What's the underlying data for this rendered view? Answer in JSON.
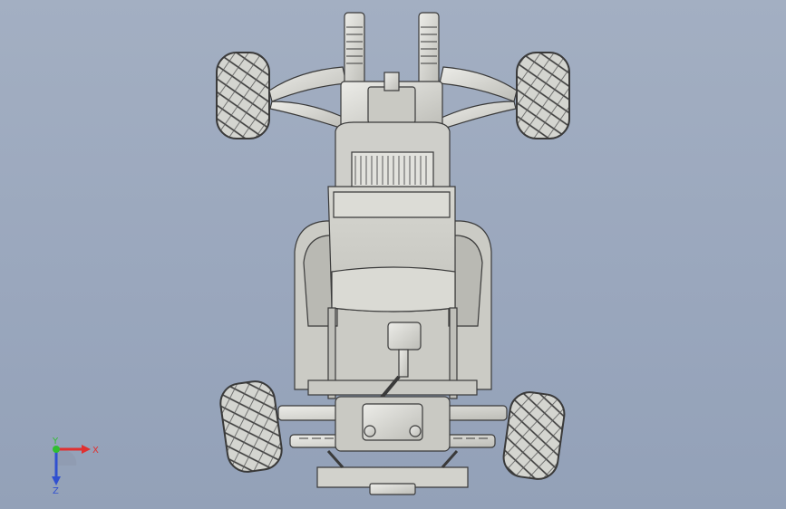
{
  "viewport": {
    "background_top": "#a3afc2",
    "background_bottom": "#93a1b8"
  },
  "model": {
    "icon": "sprint-car-chassis-assembly",
    "metal_color": "#d9d9d4",
    "edge_color": "#3a3a3a",
    "tire_color": "#cfd0cb"
  },
  "triad": {
    "x_label": "X",
    "y_label": "Y",
    "z_label": "Z",
    "x_color": "#e03030",
    "y_color": "#2fbf2f",
    "z_color": "#3050d0"
  }
}
